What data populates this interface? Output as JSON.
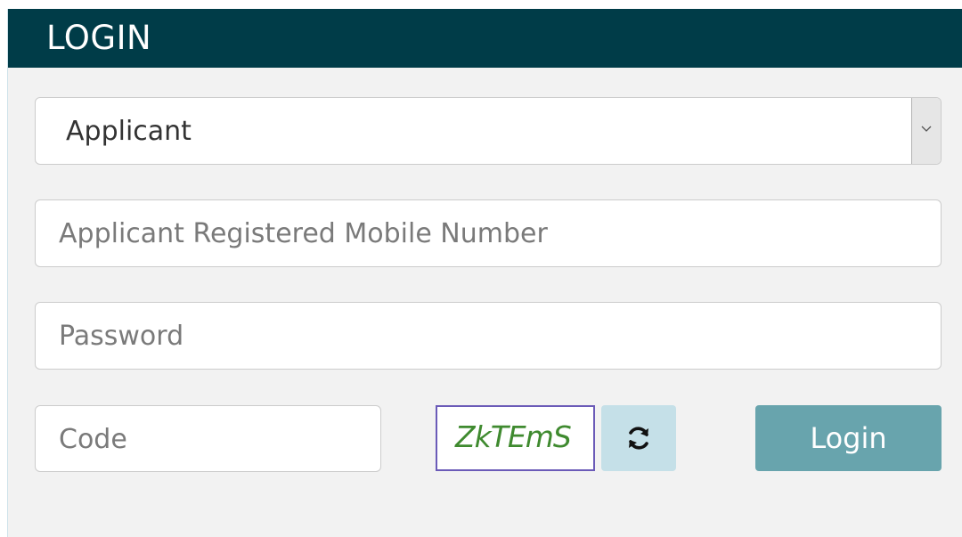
{
  "header": {
    "title": "LOGIN"
  },
  "form": {
    "user_type": {
      "selected": "Applicant"
    },
    "mobile": {
      "placeholder": "Applicant Registered Mobile Number",
      "value": ""
    },
    "password": {
      "placeholder": "Password",
      "value": ""
    },
    "code": {
      "placeholder": "Code",
      "value": ""
    },
    "captcha": {
      "text": "ZkTEmS"
    },
    "refresh_icon": "refresh-icon",
    "login_label": "Login"
  },
  "colors": {
    "header_bg": "#003c48",
    "login_button": "#68a4ad",
    "refresh_button": "#c5e0e8",
    "captcha_border": "#6b5bb8",
    "captcha_text": "#3f8a2f"
  }
}
